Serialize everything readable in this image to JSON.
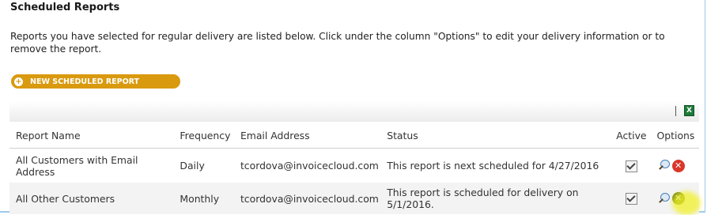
{
  "page": {
    "title": "Scheduled Reports",
    "description": "Reports you have selected for regular delivery are listed below. Click under the column \"Options\" to edit your delivery information or to remove the report.",
    "new_button_label": "NEW SCHEDULED REPORT",
    "new_button_icon": "plus-circle-icon",
    "export_icon": "excel-export-icon"
  },
  "table": {
    "headers": {
      "name": "Report Name",
      "frequency": "Frequency",
      "email": "Email Address",
      "status": "Status",
      "active": "Active",
      "options": "Options"
    },
    "rows": [
      {
        "name": "All Customers with Email Address",
        "frequency": "Daily",
        "email": "tcordova@invoicecloud.com",
        "status": "This report is next scheduled for 4/27/2016",
        "active": true
      },
      {
        "name": "All Other Customers",
        "frequency": "Monthly",
        "email": "tcordova@invoicecloud.com",
        "status": "This report is scheduled for delivery on 5/1/2016.",
        "active": true
      }
    ]
  },
  "colors": {
    "accent": "#d99a0f",
    "delete_red": "#d9372a",
    "highlight": "#f0f028"
  }
}
